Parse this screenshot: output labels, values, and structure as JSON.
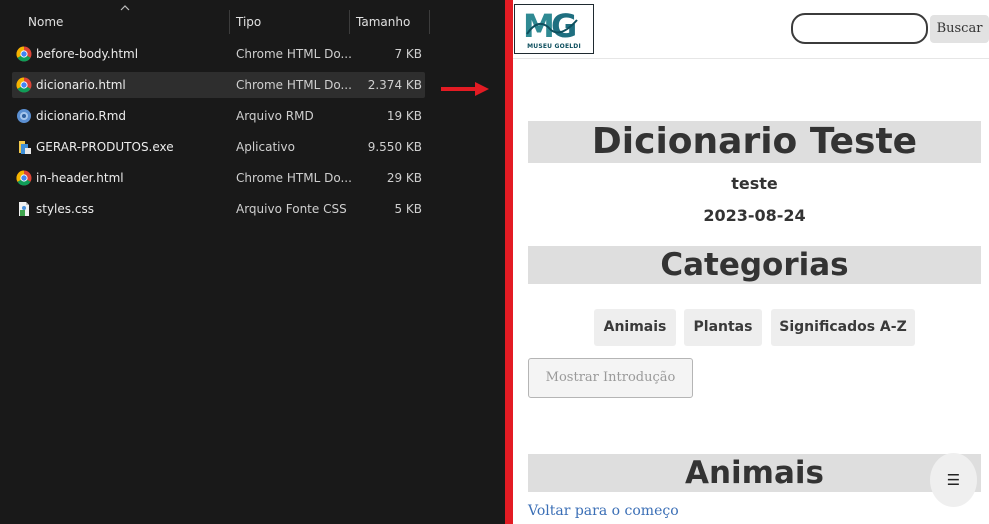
{
  "explorer": {
    "columns": {
      "name": "Nome",
      "type": "Tipo",
      "size": "Tamanho"
    },
    "files": [
      {
        "name": "before-body.html",
        "type": "Chrome HTML Do...",
        "size": "7 KB",
        "icon": "chrome-icon",
        "selected": false
      },
      {
        "name": "dicionario.html",
        "type": "Chrome HTML Do...",
        "size": "2.374 KB",
        "icon": "chrome-icon",
        "selected": true
      },
      {
        "name": "dicionario.Rmd",
        "type": "Arquivo RMD",
        "size": "19 KB",
        "icon": "rmd-file-icon",
        "selected": false
      },
      {
        "name": "GERAR-PRODUTOS.exe",
        "type": "Aplicativo",
        "size": "9.550 KB",
        "icon": "exe-file-icon",
        "selected": false
      },
      {
        "name": "in-header.html",
        "type": "Chrome HTML Do...",
        "size": "29 KB",
        "icon": "chrome-icon",
        "selected": false
      },
      {
        "name": "styles.css",
        "type": "Arquivo Fonte CSS",
        "size": "5 KB",
        "icon": "css-file-icon",
        "selected": false
      }
    ]
  },
  "browser": {
    "logo_text": "MUSEU GOELDI",
    "search": {
      "placeholder": "",
      "button": "Buscar"
    },
    "title": "Dicionario Teste",
    "author": "teste",
    "date": "2023-08-24",
    "categories_heading": "Categorias",
    "categories": [
      "Animais",
      "Plantas",
      "Significados A-Z"
    ],
    "intro_button": "Mostrar Introdução",
    "section_heading": "Animais",
    "back_link": "Voltar para o começo",
    "menu_glyph": "☰"
  },
  "colors": {
    "explorer_bg": "#191919",
    "selected_row": "#2e2e2e",
    "accent_red": "#e31b23",
    "heading_band": "#dedede",
    "link_blue": "#3b6fb6",
    "logo_teal": "#0e4f5e"
  }
}
